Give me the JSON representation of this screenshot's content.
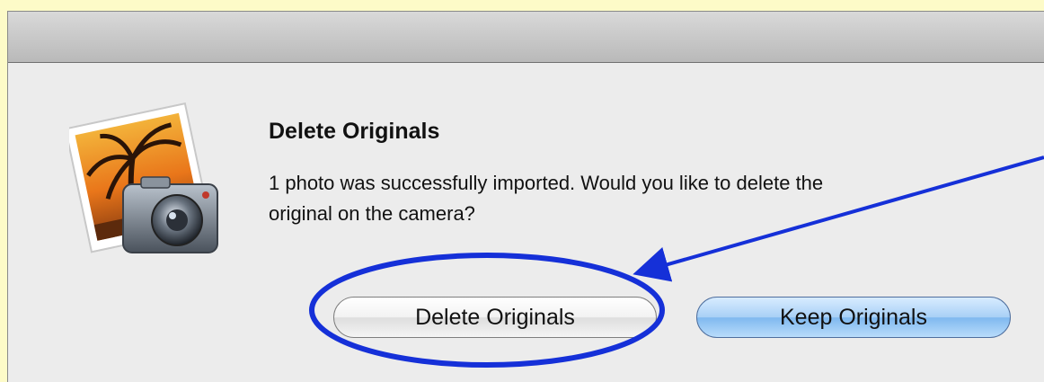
{
  "dialog": {
    "title": "Delete Originals",
    "message": "1 photo was successfully imported. Would you like to delete the original on the camera?"
  },
  "buttons": {
    "delete_label": "Delete Originals",
    "keep_label": "Keep Originals"
  },
  "icons": {
    "app": "iphoto-camera-icon"
  },
  "colors": {
    "page_background": "#fdfbc8",
    "dialog_background": "#ececec",
    "default_button": "#a8d0f6",
    "annotation": "#1530d8"
  },
  "annotation": {
    "marks": [
      "callout-ellipse",
      "callout-arrow"
    ]
  }
}
